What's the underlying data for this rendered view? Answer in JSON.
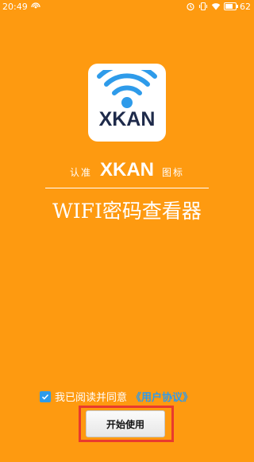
{
  "status_bar": {
    "time": "20:49",
    "battery_percent": "62",
    "icons": [
      "signal-icon",
      "alarm-icon",
      "vibrate-icon",
      "wifi-icon",
      "battery-icon"
    ]
  },
  "logo": {
    "text": "XKAN",
    "icon": "wifi-icon"
  },
  "tagline": {
    "prefix": "认准",
    "brand": "XKAN",
    "suffix": "图标"
  },
  "app_title": "WIFI密码查看器",
  "agreement": {
    "checked": true,
    "text": "我已阅读并同意",
    "link_text": "《用户协议》"
  },
  "start_button": {
    "label": "开始使用"
  },
  "colors": {
    "background": "#FE9A10",
    "accent_blue": "#2E9BEA",
    "highlight_red": "#E93A2E",
    "logo_text": "#1E2A4A"
  }
}
